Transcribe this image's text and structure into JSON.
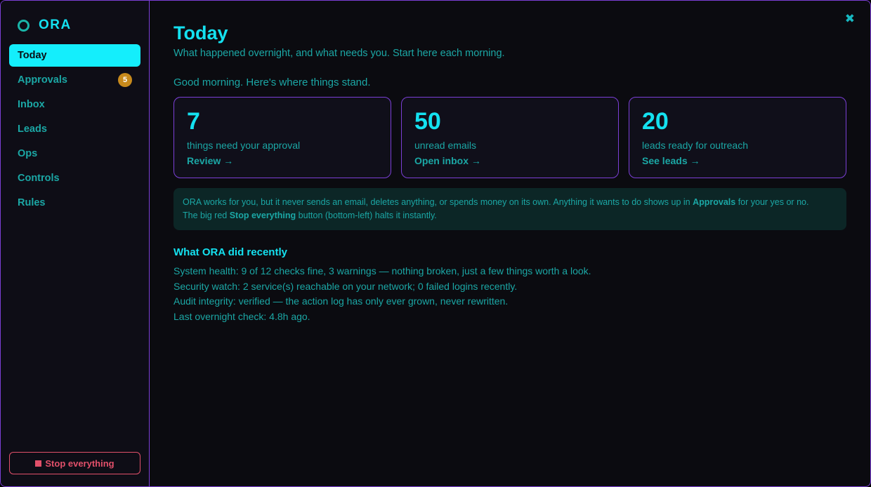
{
  "sidebar": {
    "brand": "ORA",
    "items": [
      {
        "label": "Today",
        "active": true
      },
      {
        "label": "Approvals",
        "badge": "5"
      },
      {
        "label": "Inbox"
      },
      {
        "label": "Leads"
      },
      {
        "label": "Ops"
      },
      {
        "label": "Controls"
      },
      {
        "label": "Rules"
      }
    ],
    "stop_label": "Stop everything"
  },
  "main": {
    "title": "Today",
    "subtitle": "What happened overnight, and what needs you. Start here each morning.",
    "greeting": "Good morning. Here's where things stand.",
    "cards": [
      {
        "number": "7",
        "label": "things need your approval",
        "link": "Review →"
      },
      {
        "number": "50",
        "label": "unread emails",
        "link": "Open inbox →"
      },
      {
        "number": "20",
        "label": "leads ready for outreach",
        "link": "See leads →"
      }
    ],
    "notice": {
      "part1": "ORA works for you, but it never sends an email, deletes anything, or spends money on its own. Anything it wants to do shows up in ",
      "bold1": "Approvals",
      "part2": " for your yes or no.",
      "part3": "The big red ",
      "bold2": "Stop everything",
      "part4": " button (bottom-left) halts it instantly."
    },
    "recent_title": "What ORA did recently",
    "recent": [
      "System health: 9 of 12 checks fine, 3 warnings — nothing broken, just a few things worth a look.",
      "Security watch: 2 service(s) reachable on your network; 0 failed logins recently.",
      "Audit integrity: verified — the action log has only ever grown, never rewritten.",
      "Last overnight check: 4.8h ago."
    ]
  },
  "close_icon": "close-icon",
  "colors": {
    "accent": "#14e1f0",
    "text": "#1ba7a5",
    "border": "#7b3fd6",
    "badge": "#c88a1c",
    "danger": "#e2506a"
  }
}
